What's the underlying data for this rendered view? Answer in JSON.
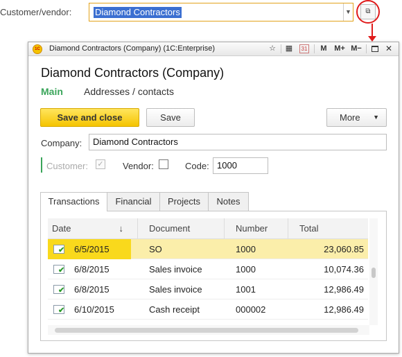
{
  "field": {
    "label": "Customer/vendor:",
    "value": "Diamond Contractors"
  },
  "window": {
    "title": "Diamond Contractors (Company)  (1C:Enterprise)",
    "toolbar": [
      "star-icon",
      "calculator-icon",
      "calendar-icon",
      "M",
      "M+",
      "M−",
      "maximize-icon",
      "close-icon"
    ],
    "toolbar_labels": {
      "m": "M",
      "mplus": "M+",
      "mminus": "M−",
      "close": "✕",
      "calendar": "31"
    }
  },
  "form": {
    "heading": "Diamond Contractors (Company)",
    "tabs": {
      "main": "Main",
      "addresses": "Addresses / contacts"
    },
    "buttons": {
      "save_close": "Save and close",
      "save": "Save",
      "more": "More"
    },
    "company_label": "Company:",
    "company_value": "Diamond Contractors",
    "customer_label": "Customer:",
    "customer_checked": true,
    "vendor_label": "Vendor:",
    "vendor_checked": false,
    "code_label": "Code:",
    "code_value": "1000"
  },
  "panel_tabs": [
    "Transactions",
    "Financial",
    "Projects",
    "Notes"
  ],
  "grid": {
    "columns": [
      "Date",
      "Document",
      "Number",
      "Total"
    ],
    "sort_indicator": "↓",
    "rows": [
      {
        "date": "6/5/2015",
        "document": "SO",
        "number": "1000",
        "total": "23,060.85"
      },
      {
        "date": "6/8/2015",
        "document": "Sales invoice",
        "number": "1000",
        "total": "10,074.36"
      },
      {
        "date": "6/8/2015",
        "document": "Sales invoice",
        "number": "1001",
        "total": "12,986.49"
      },
      {
        "date": "6/10/2015",
        "document": "Cash receipt",
        "number": "000002",
        "total": "12,986.49"
      }
    ]
  },
  "colors": {
    "accent_green": "#3aa55a",
    "primary_yellow": "#f5c400",
    "selection": "#fbeeaa",
    "annotation_red": "#e01b1b"
  }
}
